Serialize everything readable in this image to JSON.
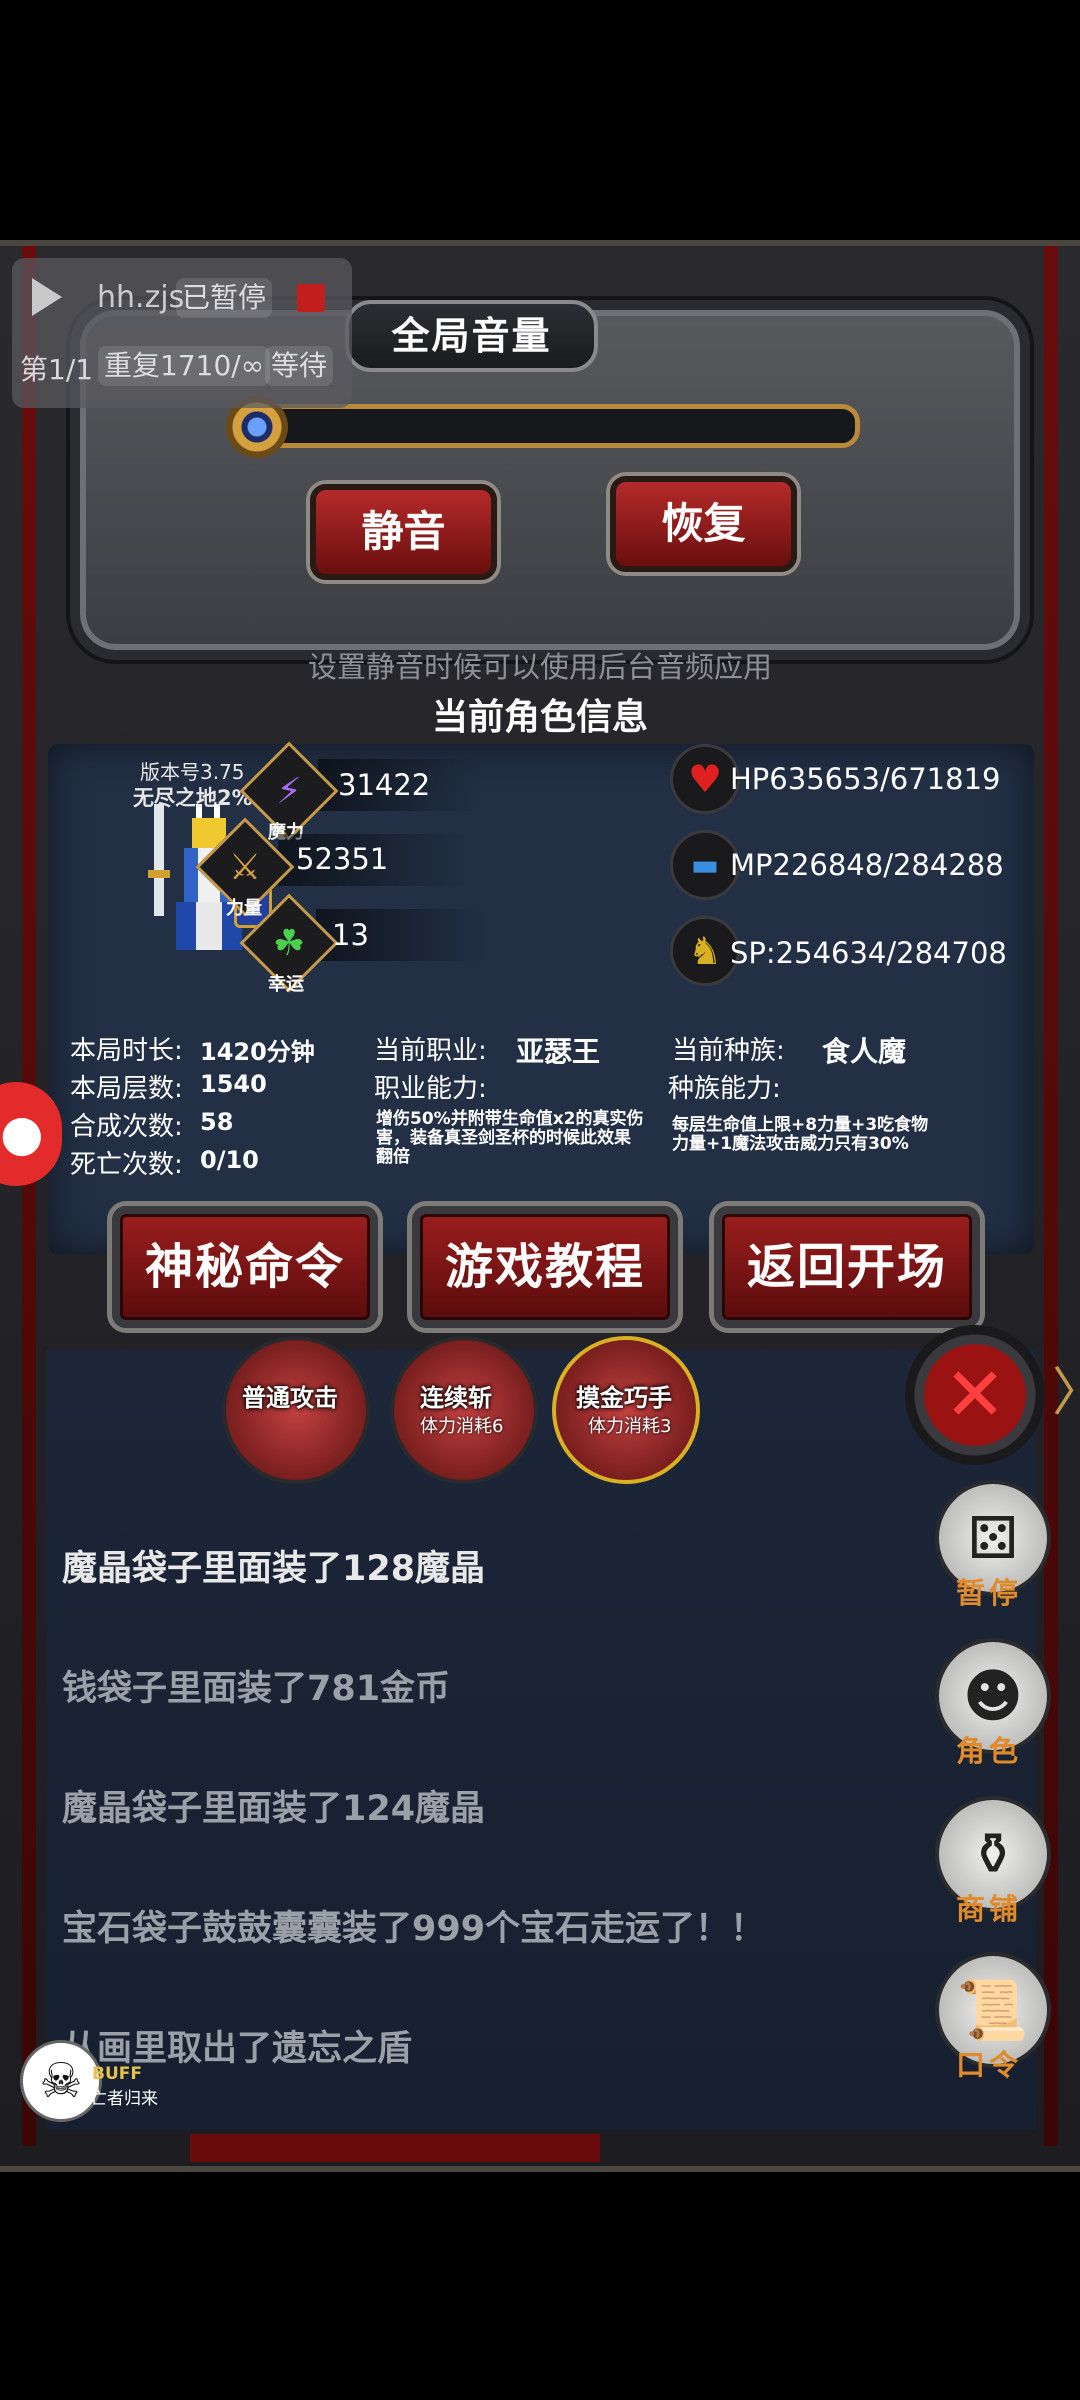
{
  "volume": {
    "title": "全局音量",
    "mute_label": "静音",
    "restore_label": "恢复",
    "hint": "设置静音时候可以使用后台音频应用",
    "level": 0
  },
  "recorder": {
    "app_name": "hh.zjs",
    "status": "已暂停",
    "page": "第1/1",
    "repeat": "重复1710/∞",
    "wait": "等待"
  },
  "character": {
    "title": "当前角色信息",
    "version": "版本号3.75",
    "zone": "无尽之地2%",
    "stats": [
      {
        "caption": "魔力",
        "value": "31422",
        "icon": "lightning-icon"
      },
      {
        "caption": "力量",
        "value": "52351",
        "icon": "spear-icon"
      },
      {
        "caption": "幸运",
        "value": "13",
        "icon": "clover-icon"
      }
    ],
    "vitals": {
      "hp": "HP635653/671819",
      "mp": "MP226848/284288",
      "sp": "SP:254634/284708"
    },
    "session": [
      {
        "label": "本局时长:",
        "value": "1420分钟"
      },
      {
        "label": "本局层数:",
        "value": "1540"
      },
      {
        "label": "合成次数:",
        "value": "58"
      },
      {
        "label": "死亡次数:",
        "value": "0/10"
      }
    ],
    "job_label": "当前职业:",
    "job_value": "亚瑟王",
    "job_ability_label": "职业能力:",
    "job_ability_desc": "增伤50%并附带生命值x2的真实伤害，装备真圣剑圣杯的时候此效果翻倍",
    "race_label": "当前种族:",
    "race_value": "食人魔",
    "race_ability_label": "种族能力:",
    "race_ability_desc": "每层生命值上限+8力量+3吃食物力量+1魔法攻击威力只有30%"
  },
  "buttons": {
    "secret_cmd": "神秘命令",
    "tutorial": "游戏教程",
    "back_to_start": "返回开场"
  },
  "skills": [
    {
      "name": "普通攻击",
      "cost": ""
    },
    {
      "name": "连续斩",
      "cost": "体力消耗6"
    },
    {
      "name": "摸金巧手",
      "cost": "体力消耗3"
    }
  ],
  "log": [
    "魔晶袋子里面装了128魔晶",
    "钱袋子里面装了781金币",
    "魔晶袋子里面装了124魔晶",
    "宝石袋子鼓鼓囊囊装了999个宝石走运了！！",
    "从画里取出了遗忘之盾"
  ],
  "side_menu": {
    "pause": "暂停",
    "role": "角色",
    "shop": "商铺",
    "password": "口令"
  },
  "buff": {
    "title": "BUFF",
    "name": "亡者归来"
  },
  "colors": {
    "accent_red": "#9b1e1e",
    "gold": "#c39a4a",
    "panel_blue": "#222f44",
    "side_label": "#e08a2a"
  }
}
